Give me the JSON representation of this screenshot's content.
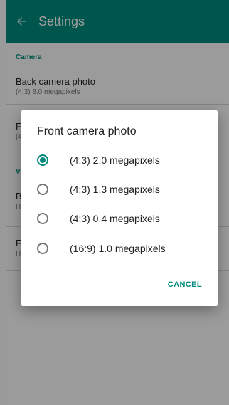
{
  "appbar": {
    "title": "Settings",
    "back_icon": "arrow-back-icon",
    "color": "#00897b"
  },
  "settings": {
    "camera_section": "Camera",
    "back_camera": {
      "title": "Back camera photo",
      "summary": "(4:3) 8.0 megapixels"
    },
    "partial_row_1": {
      "title_fragment": "F",
      "summary_fragment": "(4"
    },
    "video_section_fragment": "V",
    "partial_row_2": {
      "title_fragment": "B",
      "summary_fragment": "H"
    },
    "partial_row_3": {
      "title_fragment": "F",
      "summary_fragment": "H"
    }
  },
  "dialog": {
    "title": "Front camera photo",
    "options": [
      {
        "label": "(4:3) 2.0 megapixels",
        "selected": true
      },
      {
        "label": "(4:3) 1.3 megapixels",
        "selected": false
      },
      {
        "label": "(4:3) 0.4 megapixels",
        "selected": false
      },
      {
        "label": "(16:9) 1.0 megapixels",
        "selected": false
      }
    ],
    "cancel_label": "CANCEL"
  }
}
